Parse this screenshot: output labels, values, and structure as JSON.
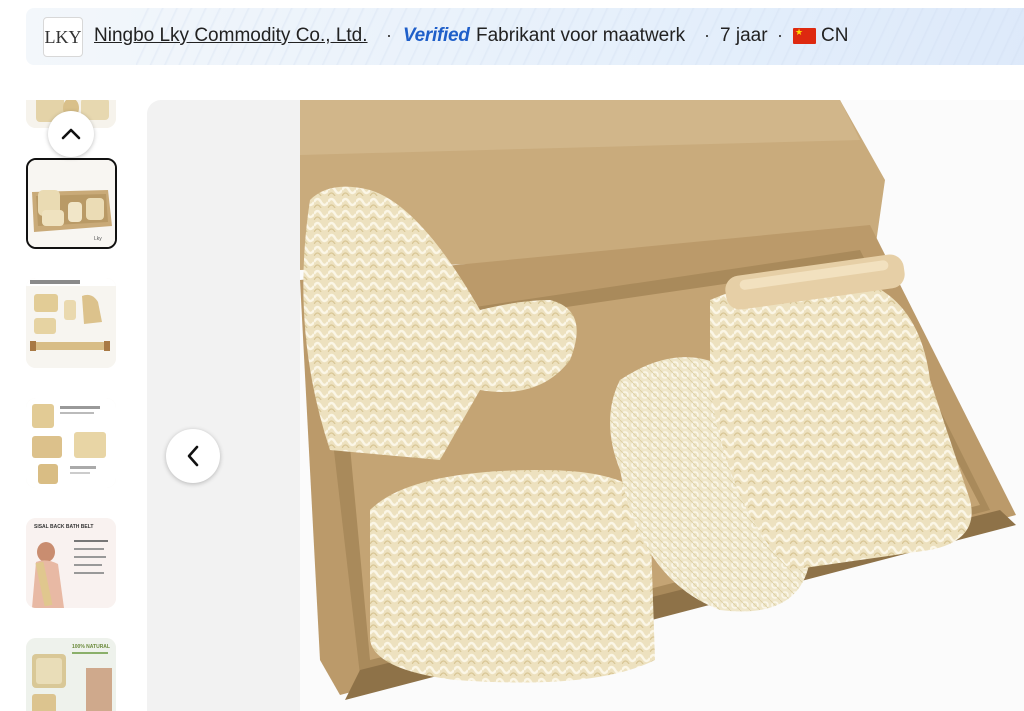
{
  "supplier": {
    "logo_text": "LKY",
    "company_name": "Ningbo Lky Commodity Co., Ltd.",
    "separator": "·",
    "verified_label": "Verified",
    "business_type": "Fabrikant voor maatwerk",
    "years": "7 jaar",
    "country": "CN",
    "verified_color": "#1f5fc9"
  },
  "gallery": {
    "thumbnails": [
      {
        "id": "thumb-1",
        "description_icon": "sisal-set-partial"
      },
      {
        "id": "thumb-2",
        "description_icon": "boxed-sisal-set",
        "active": true
      },
      {
        "id": "thumb-3",
        "description_icon": "sisal-set-layout"
      },
      {
        "id": "thumb-4",
        "description_icon": "sisal-features-grid"
      },
      {
        "id": "thumb-5",
        "description_icon": "back-strap-model"
      },
      {
        "id": "thumb-6",
        "description_icon": "sisal-natural-poster"
      }
    ],
    "thumb_texts": {
      "t5_title": "SISAL BACK BATH BELT",
      "t6_title": "100% NATURAL"
    },
    "scroll_up_icon": "chevron-up-icon",
    "prev_icon": "chevron-left-icon"
  },
  "colors": {
    "active_border": "#111111",
    "box_kraft": "#c7a97b",
    "sisal": "#efe3c2"
  }
}
